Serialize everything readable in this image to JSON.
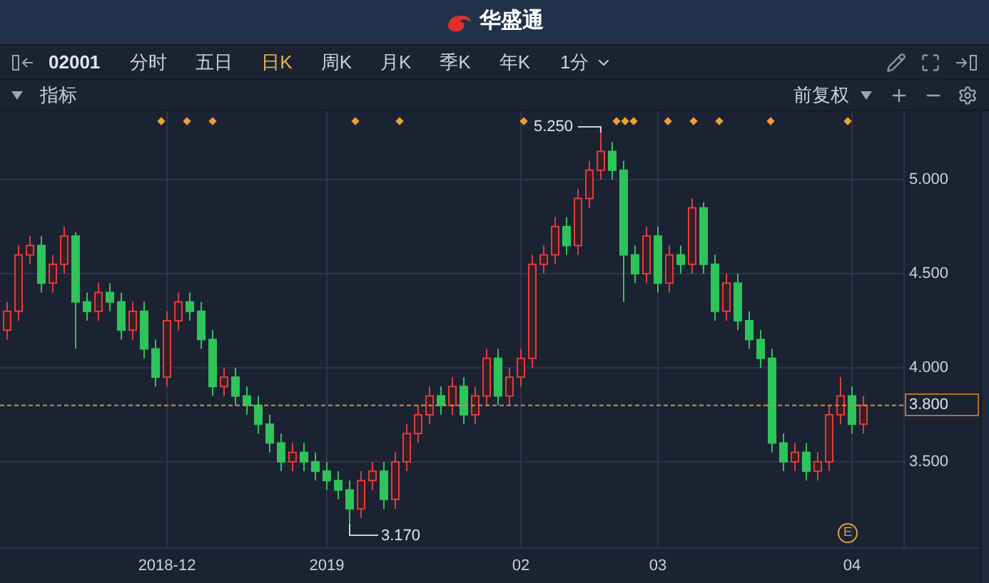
{
  "app_title": "华盛通",
  "toolbar": {
    "code": "02001",
    "tabs": [
      {
        "label": "分时",
        "selected": false
      },
      {
        "label": "五日",
        "selected": false
      },
      {
        "label": "日K",
        "selected": true
      },
      {
        "label": "周K",
        "selected": false
      },
      {
        "label": "月K",
        "selected": false
      },
      {
        "label": "季K",
        "selected": false
      },
      {
        "label": "年K",
        "selected": false
      }
    ],
    "interval": "1分"
  },
  "indicator_bar": {
    "label": "指标",
    "adjust": "前复权"
  },
  "chart": {
    "high_label": "5.250",
    "low_label": "3.170",
    "event_marker": "E",
    "chart_data": {
      "type": "candlestick",
      "ylim": [
        3.045,
        5.364
      ],
      "grid": true,
      "ref_lines": [
        {
          "axis": "y",
          "value": 3.8,
          "label": "3.800"
        }
      ],
      "yticks": [
        {
          "value": 5,
          "label": "5.000"
        },
        {
          "value": 4.5,
          "label": "4.500"
        },
        {
          "value": 4,
          "label": "4.000"
        },
        {
          "value": 3.5,
          "label": "3.500"
        }
      ],
      "categories": [
        null,
        null,
        null,
        null,
        null,
        null,
        null,
        null,
        null,
        null,
        null,
        null,
        null,
        null,
        "2018-12",
        null,
        null,
        null,
        null,
        null,
        null,
        null,
        null,
        null,
        null,
        null,
        null,
        null,
        "2019",
        null,
        null,
        null,
        null,
        null,
        null,
        null,
        null,
        null,
        null,
        null,
        null,
        null,
        null,
        null,
        null,
        "02",
        null,
        null,
        null,
        null,
        null,
        null,
        null,
        null,
        null,
        null,
        null,
        "03",
        null,
        null,
        null,
        null,
        null,
        null,
        null,
        null,
        null,
        null,
        null,
        null,
        null,
        null,
        null,
        null,
        "04",
        null
      ],
      "ohlc": [
        [
          4.2,
          4.35,
          4.15,
          4.3
        ],
        [
          4.3,
          4.65,
          4.25,
          4.6
        ],
        [
          4.6,
          4.7,
          4.55,
          4.65
        ],
        [
          4.65,
          4.7,
          4.4,
          4.45
        ],
        [
          4.45,
          4.6,
          4.4,
          4.55
        ],
        [
          4.55,
          4.75,
          4.5,
          4.7
        ],
        [
          4.7,
          4.72,
          4.1,
          4.35
        ],
        [
          4.35,
          4.4,
          4.25,
          4.3
        ],
        [
          4.3,
          4.45,
          4.25,
          4.4
        ],
        [
          4.4,
          4.45,
          4.3,
          4.35
        ],
        [
          4.35,
          4.4,
          4.15,
          4.2
        ],
        [
          4.2,
          4.35,
          4.15,
          4.3
        ],
        [
          4.3,
          4.35,
          4.05,
          4.1
        ],
        [
          4.1,
          4.15,
          3.9,
          3.95
        ],
        [
          3.95,
          4.3,
          3.9,
          4.25
        ],
        [
          4.25,
          4.4,
          4.2,
          4.35
        ],
        [
          4.35,
          4.4,
          4.25,
          4.3
        ],
        [
          4.3,
          4.35,
          4.1,
          4.15
        ],
        [
          4.15,
          4.2,
          3.85,
          3.9
        ],
        [
          3.9,
          4.0,
          3.85,
          3.95
        ],
        [
          3.95,
          4.0,
          3.8,
          3.85
        ],
        [
          3.85,
          3.9,
          3.75,
          3.8
        ],
        [
          3.8,
          3.85,
          3.65,
          3.7
        ],
        [
          3.7,
          3.75,
          3.55,
          3.6
        ],
        [
          3.6,
          3.65,
          3.45,
          3.5
        ],
        [
          3.5,
          3.6,
          3.45,
          3.55
        ],
        [
          3.55,
          3.6,
          3.45,
          3.5
        ],
        [
          3.5,
          3.55,
          3.4,
          3.45
        ],
        [
          3.45,
          3.5,
          3.35,
          3.4
        ],
        [
          3.4,
          3.45,
          3.3,
          3.35
        ],
        [
          3.35,
          3.4,
          3.17,
          3.25
        ],
        [
          3.25,
          3.45,
          3.2,
          3.4
        ],
        [
          3.4,
          3.5,
          3.35,
          3.45
        ],
        [
          3.45,
          3.5,
          3.25,
          3.3
        ],
        [
          3.3,
          3.55,
          3.25,
          3.5
        ],
        [
          3.5,
          3.7,
          3.45,
          3.65
        ],
        [
          3.65,
          3.8,
          3.6,
          3.75
        ],
        [
          3.75,
          3.9,
          3.7,
          3.85
        ],
        [
          3.85,
          3.9,
          3.75,
          3.8
        ],
        [
          3.8,
          3.95,
          3.75,
          3.9
        ],
        [
          3.9,
          3.95,
          3.7,
          3.75
        ],
        [
          3.75,
          3.9,
          3.7,
          3.85
        ],
        [
          3.85,
          4.1,
          3.8,
          4.05
        ],
        [
          4.05,
          4.1,
          3.8,
          3.85
        ],
        [
          3.85,
          4.0,
          3.8,
          3.95
        ],
        [
          3.95,
          4.1,
          3.9,
          4.05
        ],
        [
          4.05,
          4.6,
          4.0,
          4.55
        ],
        [
          4.55,
          4.65,
          4.5,
          4.6
        ],
        [
          4.6,
          4.8,
          4.55,
          4.75
        ],
        [
          4.75,
          4.8,
          4.6,
          4.65
        ],
        [
          4.65,
          4.95,
          4.6,
          4.9
        ],
        [
          4.9,
          5.1,
          4.85,
          5.05
        ],
        [
          5.05,
          5.25,
          5.0,
          5.15
        ],
        [
          5.15,
          5.2,
          5.0,
          5.05
        ],
        [
          5.05,
          5.1,
          4.35,
          4.6
        ],
        [
          4.6,
          4.65,
          4.45,
          4.5
        ],
        [
          4.5,
          4.75,
          4.45,
          4.7
        ],
        [
          4.7,
          4.75,
          4.4,
          4.45
        ],
        [
          4.45,
          4.65,
          4.4,
          4.6
        ],
        [
          4.6,
          4.65,
          4.5,
          4.55
        ],
        [
          4.55,
          4.9,
          4.5,
          4.85
        ],
        [
          4.85,
          4.88,
          4.5,
          4.55
        ],
        [
          4.55,
          4.6,
          4.25,
          4.3
        ],
        [
          4.3,
          4.5,
          4.25,
          4.45
        ],
        [
          4.45,
          4.5,
          4.2,
          4.25
        ],
        [
          4.25,
          4.3,
          4.1,
          4.15
        ],
        [
          4.15,
          4.2,
          4.0,
          4.05
        ],
        [
          4.05,
          4.1,
          3.55,
          3.6
        ],
        [
          3.6,
          3.65,
          3.45,
          3.5
        ],
        [
          3.5,
          3.6,
          3.45,
          3.55
        ],
        [
          3.55,
          3.6,
          3.4,
          3.45
        ],
        [
          3.45,
          3.55,
          3.4,
          3.5
        ],
        [
          3.5,
          3.8,
          3.45,
          3.75
        ],
        [
          3.75,
          3.95,
          3.7,
          3.85
        ],
        [
          3.85,
          3.9,
          3.65,
          3.7
        ],
        [
          3.7,
          3.85,
          3.65,
          3.8
        ]
      ]
    }
  }
}
